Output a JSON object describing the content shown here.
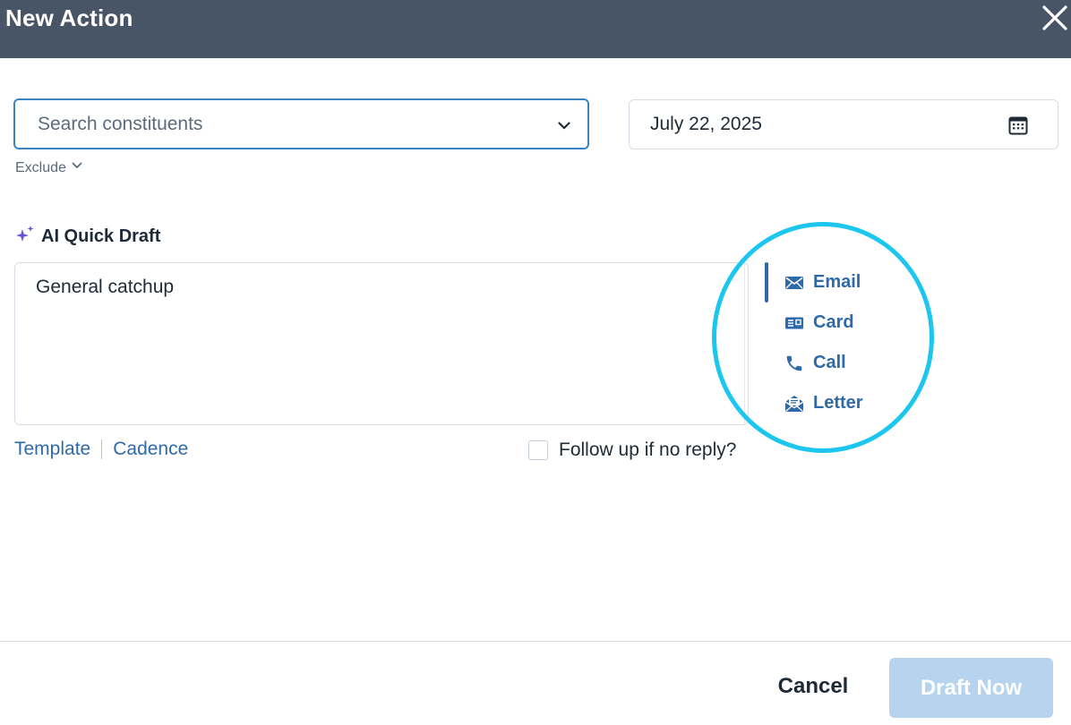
{
  "header": {
    "title": "New Action",
    "close_icon": "close-icon"
  },
  "search": {
    "placeholder": "Search constituents",
    "value": "",
    "chevron_icon": "chevron-down-icon"
  },
  "exclude": {
    "label": "Exclude",
    "icon": "chevron-down-icon"
  },
  "date": {
    "value": "July 22, 2025",
    "icon": "calendar-icon"
  },
  "ai_quick_draft": {
    "label": "AI Quick Draft",
    "icon": "sparkle-icon",
    "text": "General catchup"
  },
  "channels": [
    {
      "label": "Email",
      "icon": "envelope-icon",
      "active": true
    },
    {
      "label": "Card",
      "icon": "card-icon",
      "active": false
    },
    {
      "label": "Call",
      "icon": "phone-icon",
      "active": false
    },
    {
      "label": "Letter",
      "icon": "letter-icon",
      "active": false
    }
  ],
  "links": {
    "template": "Template",
    "cadence": "Cadence"
  },
  "followup": {
    "label": "Follow up if no reply?",
    "checked": false
  },
  "footer": {
    "cancel_label": "Cancel",
    "draft_now_label": "Draft Now"
  },
  "colors": {
    "header_bg": "#485566",
    "accent": "#2e6aa9",
    "focus_border": "#3b84c4",
    "highlight_ring": "#1cc6ee",
    "ai_sparkle": "#6a4fd2",
    "disabled_button": "#b7d4ef"
  }
}
